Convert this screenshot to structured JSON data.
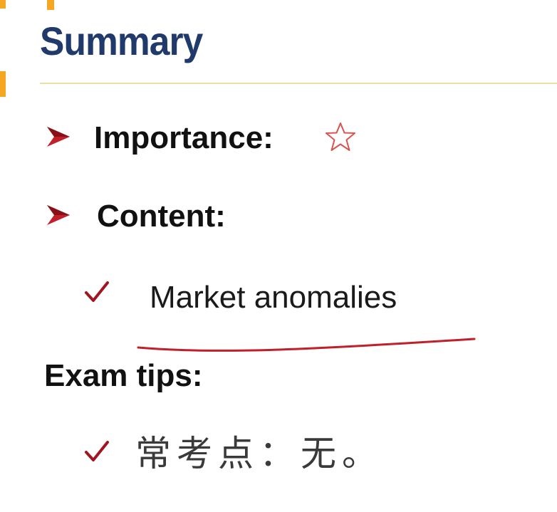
{
  "slide": {
    "title": "Summary",
    "accent_color": "#f5a623",
    "title_color": "#1f3a6b",
    "bullet_color": "#c0202a",
    "items": [
      {
        "label": "Importance:",
        "icon": "star-outline-icon"
      },
      {
        "label": "Content:"
      }
    ],
    "content_points": [
      {
        "text": "Market anomalies",
        "annotation": "red-underline"
      }
    ],
    "tips_heading": "Exam tips:",
    "tips_points": [
      {
        "text": "常考点：无。"
      }
    ]
  }
}
